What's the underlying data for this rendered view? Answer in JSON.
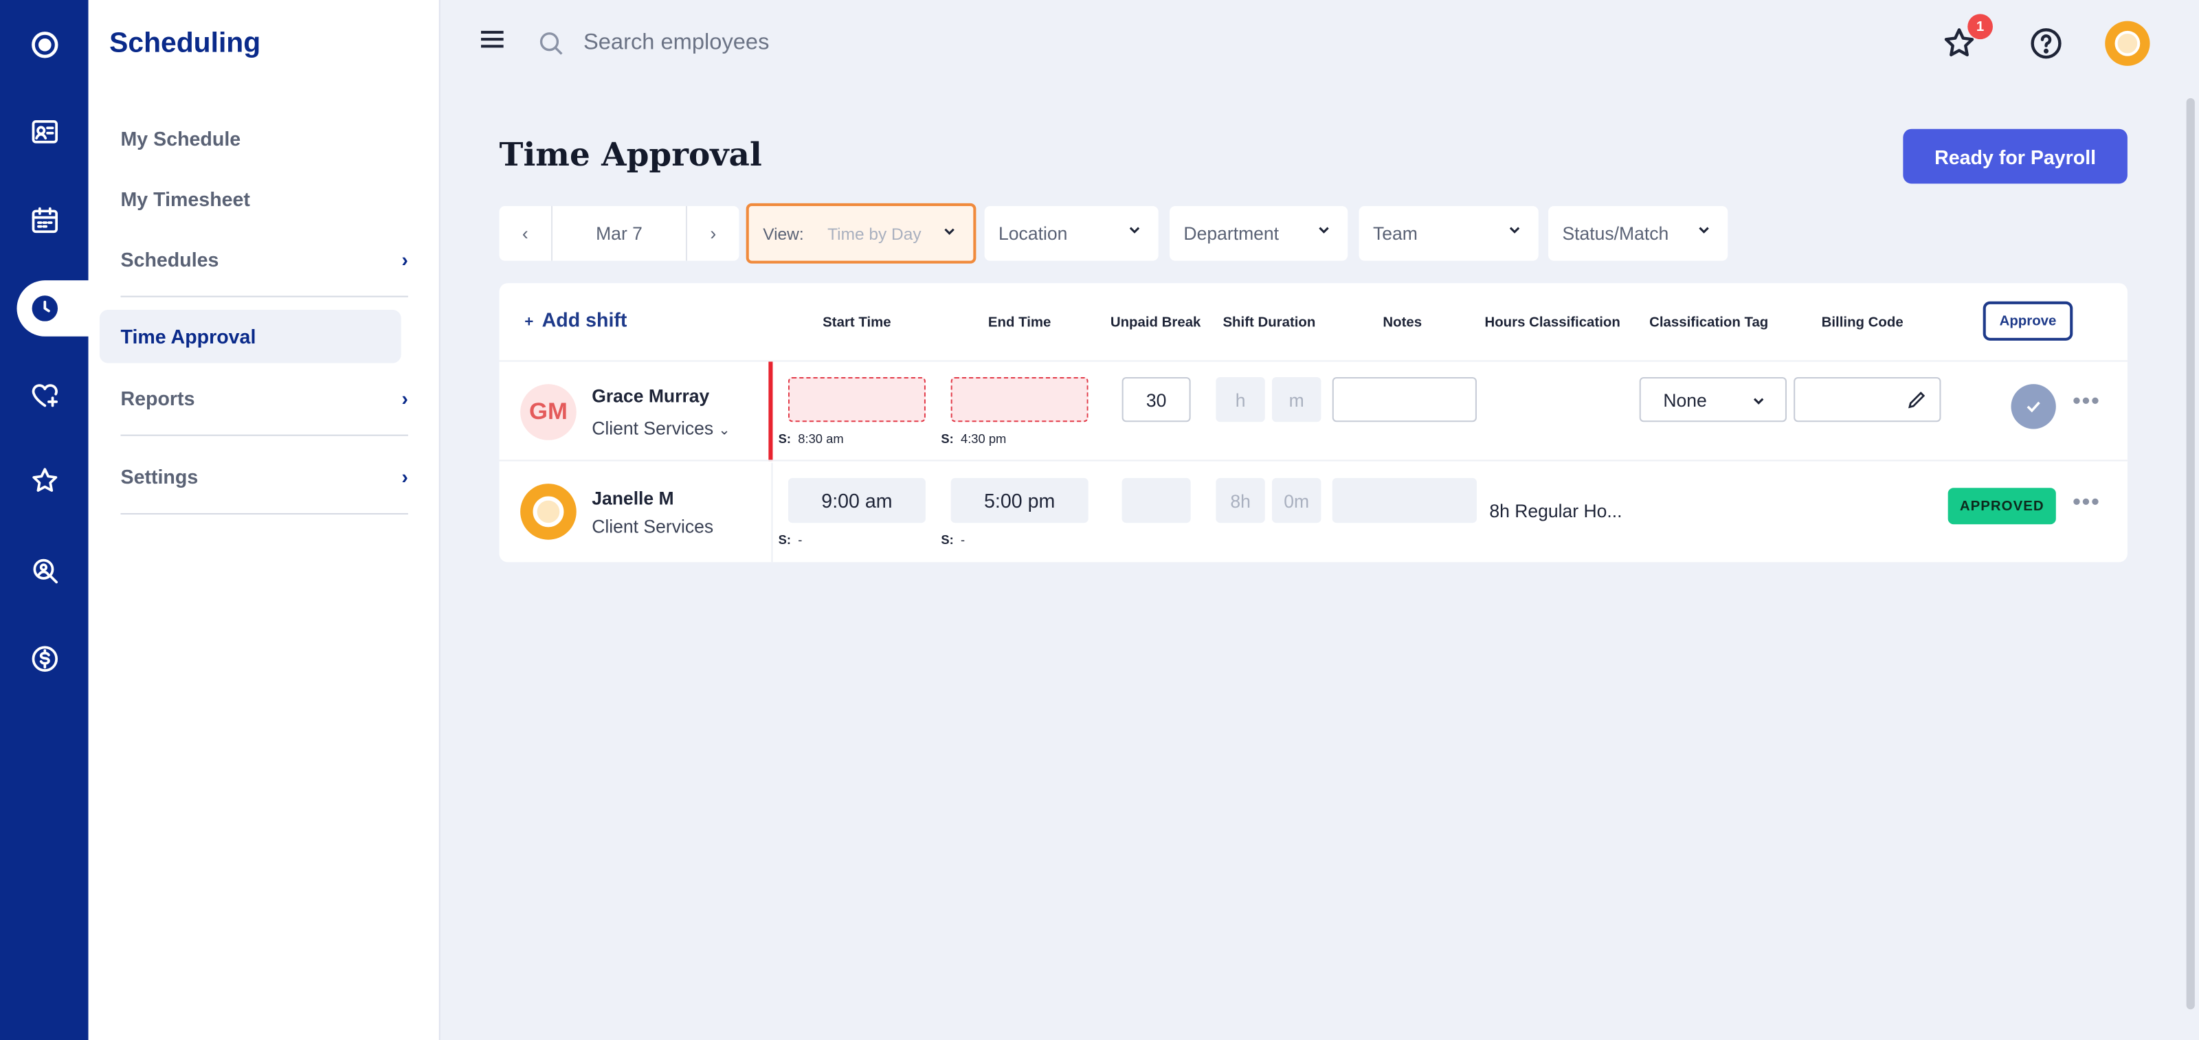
{
  "app": {
    "section_title": "Scheduling"
  },
  "sidebar": {
    "items": [
      {
        "label": "My Schedule"
      },
      {
        "label": "My Timesheet"
      },
      {
        "label": "Schedules"
      },
      {
        "label": "Time Approval"
      },
      {
        "label": "Reports"
      },
      {
        "label": "Settings"
      }
    ],
    "active": "Time Approval"
  },
  "rail": {
    "icons": [
      "logo-icon",
      "id-card-icon",
      "calendar-icon",
      "clock-icon",
      "heart-plus-icon",
      "star-icon",
      "search-person-icon",
      "dollar-icon"
    ]
  },
  "topbar": {
    "search_placeholder": "Search employees",
    "notification_count": "1"
  },
  "page": {
    "title": "Time Approval",
    "payroll_button": "Ready for Payroll"
  },
  "filters": {
    "date": "Mar 7",
    "view_label": "View:",
    "view_value": "Time by Day",
    "location": "Location",
    "department": "Department",
    "team": "Team",
    "status": "Status/Match"
  },
  "table": {
    "add_shift": "Add shift",
    "columns": [
      "Start Time",
      "End Time",
      "Unpaid Break",
      "Shift Duration",
      "Notes",
      "Hours Classification",
      "Classification Tag",
      "Billing Code",
      "Approve"
    ],
    "rows": [
      {
        "initials": "GM",
        "name": "Grace Murray",
        "department": "Client Services",
        "start": "",
        "end": "",
        "sched_start": "8:30 am",
        "sched_end": "4:30 pm",
        "sched_prefix": "S:",
        "unpaid_break": "30",
        "duration_h": "h",
        "duration_m": "m",
        "classification_tag": "None"
      },
      {
        "initials": "",
        "name": "Janelle M",
        "department": "Client Services",
        "start": "9:00 am",
        "end": "5:00 pm",
        "sched_start": "-",
        "sched_end": "-",
        "sched_prefix": "S:",
        "duration_h": "8h",
        "duration_m": "0m",
        "hours_classification": "8h Regular Ho...",
        "status": "APPROVED"
      }
    ]
  },
  "colors": {
    "rail": "#0a2a8a",
    "primary": "#4a5be0",
    "approved": "#16c98a",
    "alert": "#e8232f",
    "view_highlight": "#f08a3c"
  }
}
